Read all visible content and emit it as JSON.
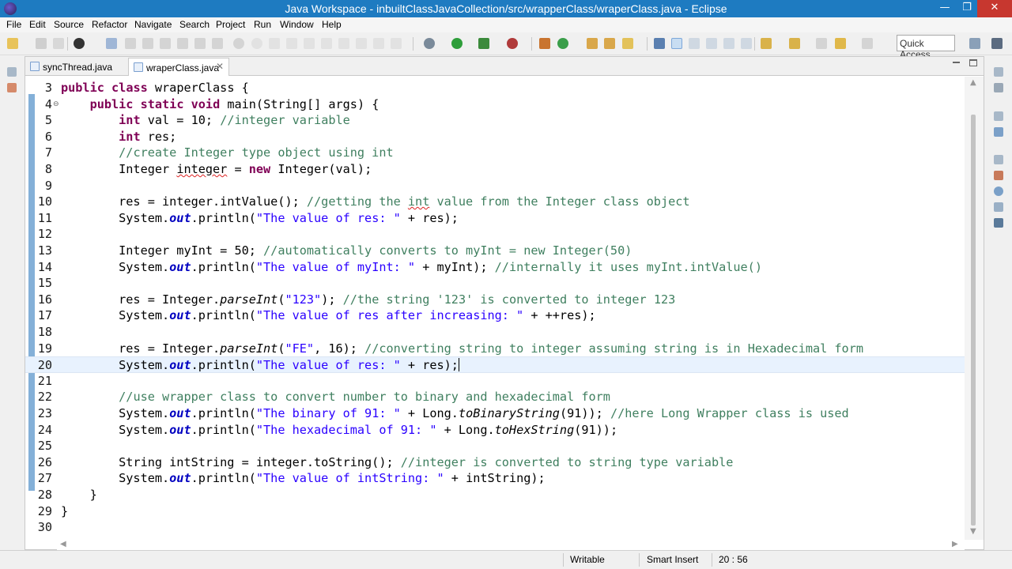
{
  "window": {
    "title": "Java Workspace - inbuiltClassJavaCollection/src/wrapperClass/wraperClass.java - Eclipse",
    "min": "—",
    "max": "❐",
    "close": "✕"
  },
  "menu": [
    "File",
    "Edit",
    "Source",
    "Refactor",
    "Navigate",
    "Search",
    "Project",
    "Run",
    "Window",
    "Help"
  ],
  "toolbar": {
    "quick_access": "Quick Access"
  },
  "tabs": [
    {
      "label": "syncThread.java",
      "active": false
    },
    {
      "label": "wraperClass.java",
      "active": true,
      "close": "✕"
    }
  ],
  "editor": {
    "current_line": "20",
    "lines": [
      {
        "n": "3",
        "code": "public class wraperClass {"
      },
      {
        "n": "4",
        "code": "    public static void main(String[] args) {",
        "fold": "⊖"
      },
      {
        "n": "5",
        "code": "        int val = 10; //integer variable"
      },
      {
        "n": "6",
        "code": "        int res;"
      },
      {
        "n": "7",
        "code": "        //create Integer type object using int"
      },
      {
        "n": "8",
        "code": "        Integer integer = new Integer(val);"
      },
      {
        "n": "9",
        "code": ""
      },
      {
        "n": "10",
        "code": "        res = integer.intValue(); //getting the int value from the Integer class object"
      },
      {
        "n": "11",
        "code": "        System.out.println(\"The value of res: \" + res);"
      },
      {
        "n": "12",
        "code": ""
      },
      {
        "n": "13",
        "code": "        Integer myInt = 50; //automatically converts to myInt = new Integer(50)"
      },
      {
        "n": "14",
        "code": "        System.out.println(\"The value of myInt: \" + myInt); //internally it uses myInt.intValue()"
      },
      {
        "n": "15",
        "code": ""
      },
      {
        "n": "16",
        "code": "        res = Integer.parseInt(\"123\"); //the string '123' is converted to integer 123"
      },
      {
        "n": "17",
        "code": "        System.out.println(\"The value of res after increasing: \" + ++res);"
      },
      {
        "n": "18",
        "code": ""
      },
      {
        "n": "19",
        "code": "        res = Integer.parseInt(\"FE\", 16); //converting string to integer assuming string is in Hexadecimal form"
      },
      {
        "n": "20",
        "code": "        System.out.println(\"The value of res: \" + res);"
      },
      {
        "n": "21",
        "code": ""
      },
      {
        "n": "22",
        "code": "        //use wrapper class to convert number to binary and hexadecimal form"
      },
      {
        "n": "23",
        "code": "        System.out.println(\"The binary of 91: \" + Long.toBinaryString(91)); //here Long Wrapper class is used"
      },
      {
        "n": "24",
        "code": "        System.out.println(\"The hexadecimal of 91: \" + Long.toHexString(91));"
      },
      {
        "n": "25",
        "code": ""
      },
      {
        "n": "26",
        "code": "        String intString = integer.toString(); //integer is converted to string type variable"
      },
      {
        "n": "27",
        "code": "        System.out.println(\"The value of intString: \" + intString);"
      },
      {
        "n": "28",
        "code": "    }"
      },
      {
        "n": "29",
        "code": "}"
      },
      {
        "n": "30",
        "code": ""
      }
    ]
  },
  "status": {
    "writable": "Writable",
    "insert_mode": "Smart Insert",
    "position": "20 : 56"
  }
}
